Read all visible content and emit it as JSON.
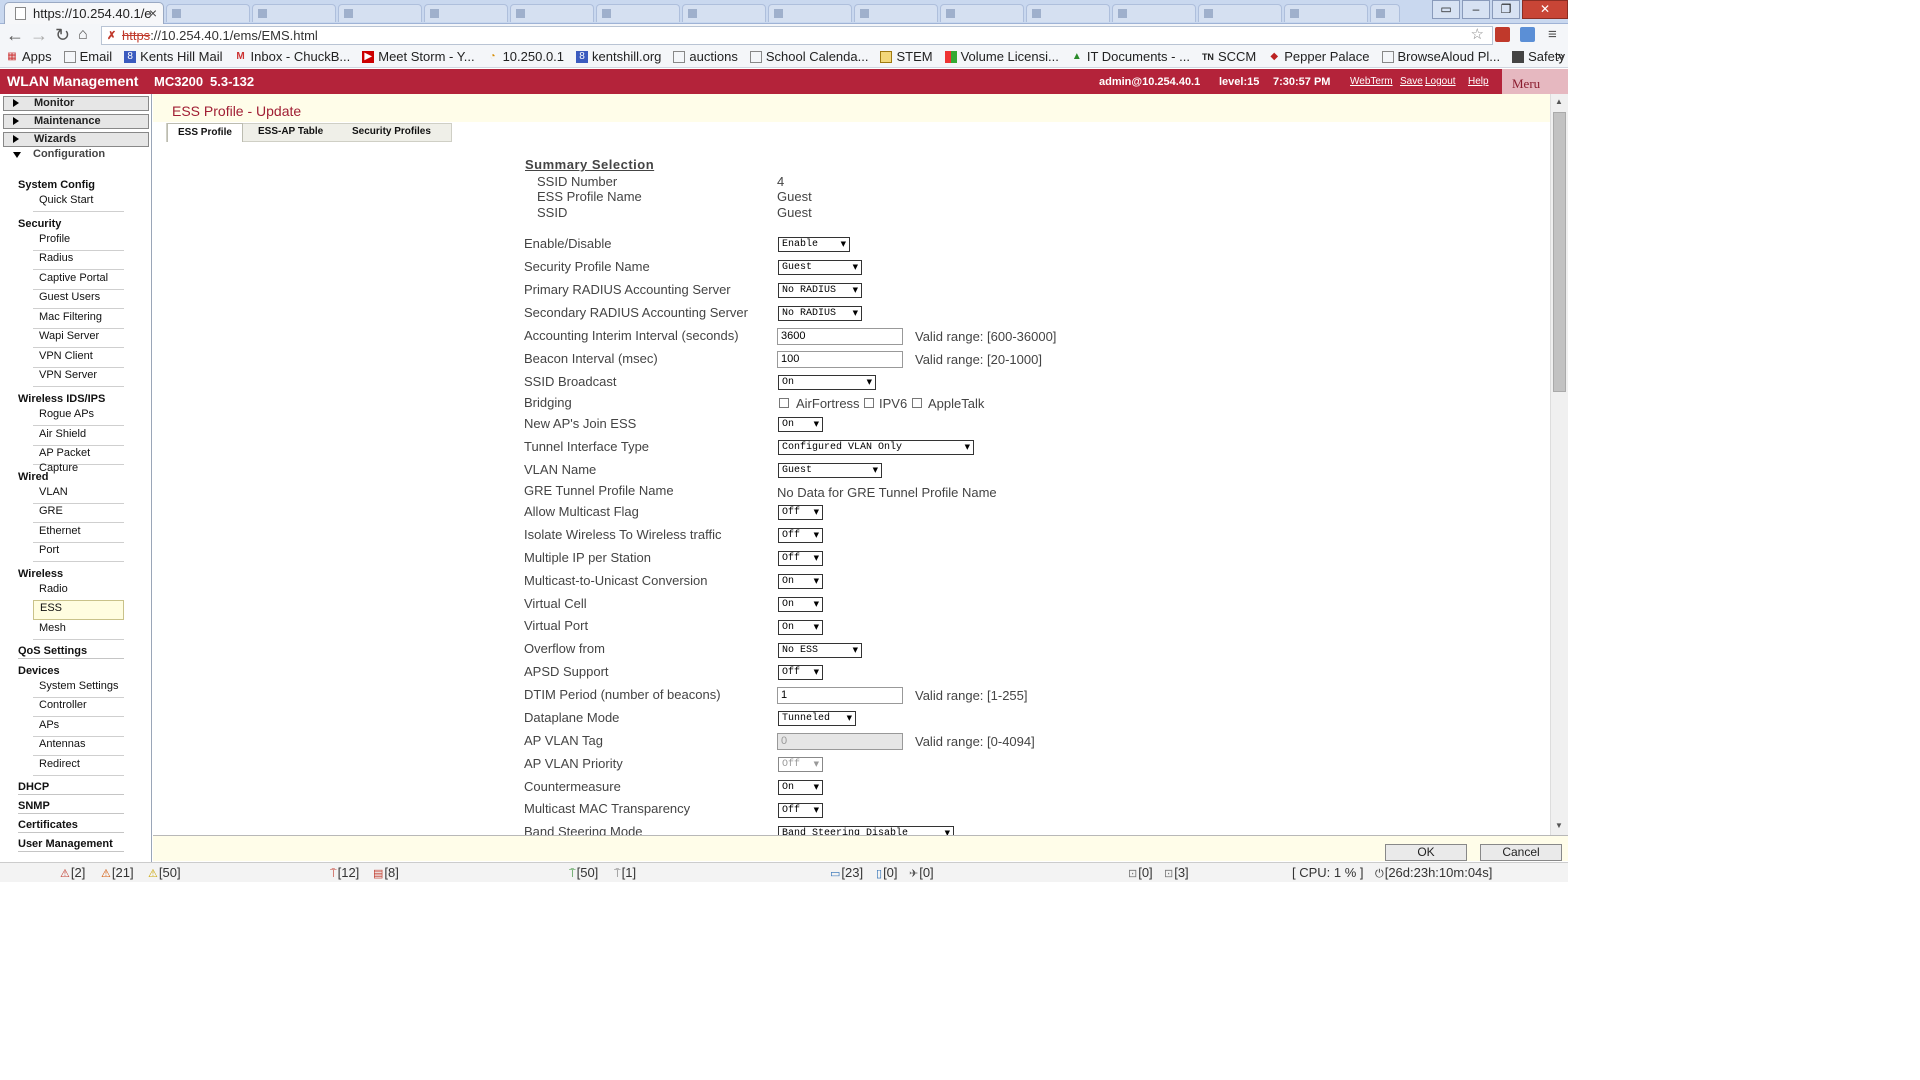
{
  "browser": {
    "tab_title": "https://10.254.40.1/e",
    "url_scheme": "https",
    "url_rest": "://10.254.40.1/ems/EMS.html",
    "bookmarks": [
      "Apps",
      "Email",
      "Kents Hill Mail",
      "Inbox - ChuckB...",
      "Meet Storm - Y...",
      "10.250.0.1",
      "kentshill.org",
      "auctions",
      "School Calenda...",
      "STEM",
      "Volume Licensi...",
      "IT Documents - ...",
      "SCCM",
      "Pepper Palace",
      "BrowseAloud Pl...",
      "Safety Solutions..."
    ],
    "bookmarks_more": "»"
  },
  "app": {
    "title": "WLAN Management",
    "model": "MC3200",
    "version": "5.3-132",
    "user": "admin@10.254.40.1",
    "level": "level:15",
    "time": "7:30:57 PM",
    "links": [
      "WebTerm",
      "Save",
      "Logout",
      "Help"
    ],
    "logo": "Meru"
  },
  "sidebar": {
    "top_menus": [
      "Monitor",
      "Maintenance",
      "Wizards"
    ],
    "configuration": "Configuration",
    "system_config": "System Config",
    "quick_start": "Quick Start",
    "security": "Security",
    "security_items": [
      "Profile",
      "Radius",
      "Captive Portal",
      "Guest Users",
      "Mac Filtering",
      "Wapi Server",
      "VPN Client",
      "VPN Server"
    ],
    "wids": "Wireless IDS/IPS",
    "wids_items": [
      "Rogue APs",
      "Air Shield",
      "AP Packet Capture"
    ],
    "wired": "Wired",
    "wired_items": [
      "VLAN",
      "GRE",
      "Ethernet",
      "Port"
    ],
    "wireless": "Wireless",
    "wireless_items": [
      "Radio",
      "ESS",
      "Mesh"
    ],
    "qos": "QoS Settings",
    "devices": "Devices",
    "devices_items": [
      "System Settings",
      "Controller",
      "APs",
      "Antennas",
      "Redirect"
    ],
    "dhcp": "DHCP",
    "snmp": "SNMP",
    "certificates": "Certificates",
    "user_mgmt": "User Management"
  },
  "page": {
    "title": "ESS Profile - Update",
    "tabs": [
      "ESS Profile",
      "ESS-AP Table",
      "Security Profiles"
    ],
    "summary_title": "Summary Selection",
    "summary": [
      {
        "label": "SSID Number",
        "value": "4"
      },
      {
        "label": "ESS Profile Name",
        "value": "Guest"
      },
      {
        "label": "SSID",
        "value": "Guest"
      }
    ],
    "fields": {
      "enable_label": "Enable/Disable",
      "enable_value": "Enable",
      "secprof_label": "Security Profile Name",
      "secprof_value": "Guest",
      "prad_label": "Primary RADIUS Accounting Server",
      "prad_value": "No RADIUS",
      "srad_label": "Secondary RADIUS Accounting Server",
      "srad_value": "No RADIUS",
      "acct_label": "Accounting Interim Interval (seconds)",
      "acct_value": "3600",
      "acct_range": "Valid range: [600-36000]",
      "beacon_label": "Beacon Interval (msec)",
      "beacon_value": "100",
      "beacon_range": "Valid range: [20-1000]",
      "ssidb_label": "SSID Broadcast",
      "ssidb_value": "On",
      "bridging_label": "Bridging",
      "bridging_options": [
        "AirFortress",
        "IPV6",
        "AppleTalk"
      ],
      "newap_label": "New AP's Join ESS",
      "newap_value": "On",
      "tunnel_label": "Tunnel Interface Type",
      "tunnel_value": "Configured VLAN Only",
      "vlan_label": "VLAN Name",
      "vlan_value": "Guest",
      "gre_label": "GRE Tunnel Profile Name",
      "gre_value": "No Data for GRE Tunnel Profile Name",
      "mcast_label": "Allow Multicast Flag",
      "mcast_value": "Off",
      "isolate_label": "Isolate Wireless To Wireless traffic",
      "isolate_value": "Off",
      "multiip_label": "Multiple IP per Station",
      "multiip_value": "Off",
      "m2u_label": "Multicast-to-Unicast Conversion",
      "m2u_value": "On",
      "vcell_label": "Virtual Cell",
      "vcell_value": "On",
      "vport_label": "Virtual Port",
      "vport_value": "On",
      "overflow_label": "Overflow from",
      "overflow_value": "No ESS",
      "apsd_label": "APSD Support",
      "apsd_value": "Off",
      "dtim_label": "DTIM Period (number of beacons)",
      "dtim_value": "1",
      "dtim_range": "Valid range: [1-255]",
      "dataplane_label": "Dataplane Mode",
      "dataplane_value": "Tunneled",
      "apvlan_label": "AP VLAN Tag",
      "apvlan_value": "0",
      "apvlan_range": "Valid range: [0-4094]",
      "apvlanprio_label": "AP VLAN Priority",
      "apvlanprio_value": "Off",
      "counter_label": "Countermeasure",
      "counter_value": "On",
      "mcmac_label": "Multicast MAC Transparency",
      "mcmac_value": "Off",
      "band_label": "Band Steering Mode",
      "band_value": "Band Steering Disable"
    },
    "ok_label": "OK",
    "cancel_label": "Cancel"
  },
  "status": {
    "alarm_crit": "[2]",
    "alarm_major": "[21]",
    "alarm_minor": "[50]",
    "ap_down": "[12]",
    "ap_other": "[8]",
    "ap_up": "[50]",
    "ap_up2": "[1]",
    "clients": "[23]",
    "c2": "[0]",
    "c3": "[0]",
    "lock1": "[0]",
    "lock2": "[3]",
    "cpu": "[ CPU: 1 % ]",
    "uptime": "[26d:23h:10m:04s]"
  },
  "colors": {
    "brand": "#b4233a",
    "title": "#a01e34",
    "header_bg": "#fffde9"
  }
}
